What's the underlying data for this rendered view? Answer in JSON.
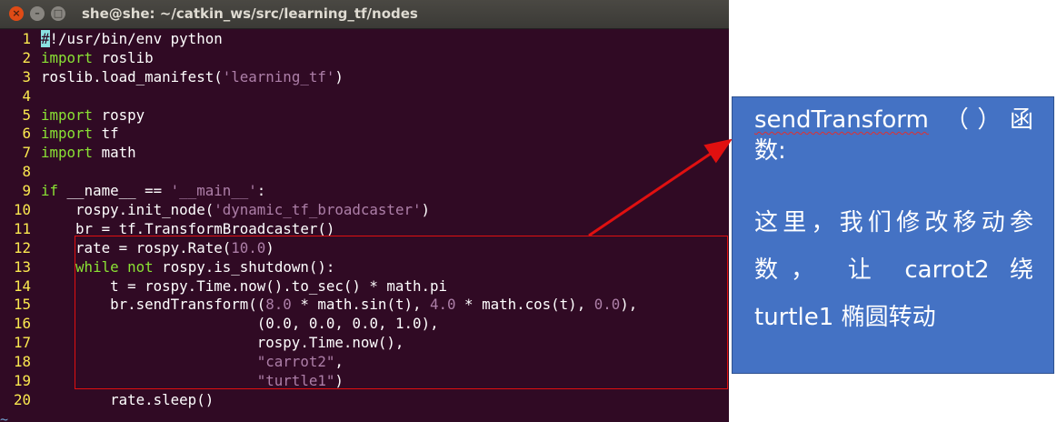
{
  "window": {
    "title": "she@she: ~/catkin_ws/src/learning_tf/nodes",
    "close_glyph": "×",
    "min_glyph": "–",
    "max_glyph": "□"
  },
  "code": {
    "lines": [
      {
        "n": "1",
        "segs": [
          {
            "t": "#",
            "c": "cursor"
          },
          {
            "t": "!/usr/bin/env python",
            "c": "comment"
          }
        ]
      },
      {
        "n": "2",
        "segs": [
          {
            "t": "import",
            "c": "kw"
          },
          {
            "t": " roslib",
            "c": ""
          }
        ]
      },
      {
        "n": "3",
        "segs": [
          {
            "t": "roslib.load_manifest(",
            "c": ""
          },
          {
            "t": "'learning_tf'",
            "c": "str"
          },
          {
            "t": ")",
            "c": ""
          }
        ]
      },
      {
        "n": "4",
        "segs": []
      },
      {
        "n": "5",
        "segs": [
          {
            "t": "import",
            "c": "kw"
          },
          {
            "t": " rospy",
            "c": ""
          }
        ]
      },
      {
        "n": "6",
        "segs": [
          {
            "t": "import",
            "c": "kw"
          },
          {
            "t": " tf",
            "c": ""
          }
        ]
      },
      {
        "n": "7",
        "segs": [
          {
            "t": "import",
            "c": "kw"
          },
          {
            "t": " math",
            "c": ""
          }
        ]
      },
      {
        "n": "8",
        "segs": []
      },
      {
        "n": "9",
        "segs": [
          {
            "t": "if",
            "c": "kw"
          },
          {
            "t": " __name__ == ",
            "c": ""
          },
          {
            "t": "'__main__'",
            "c": "str"
          },
          {
            "t": ":",
            "c": ""
          }
        ]
      },
      {
        "n": "10",
        "segs": [
          {
            "t": "    rospy.init_node(",
            "c": ""
          },
          {
            "t": "'dynamic_tf_broadcaster'",
            "c": "str"
          },
          {
            "t": ")",
            "c": ""
          }
        ]
      },
      {
        "n": "11",
        "segs": [
          {
            "t": "    br = tf.TransformBroadcaster()",
            "c": ""
          }
        ]
      },
      {
        "n": "12",
        "segs": [
          {
            "t": "    rate = rospy.Rate(",
            "c": ""
          },
          {
            "t": "10.0",
            "c": "num"
          },
          {
            "t": ")",
            "c": ""
          }
        ]
      },
      {
        "n": "13",
        "segs": [
          {
            "t": "    ",
            "c": ""
          },
          {
            "t": "while",
            "c": "kw"
          },
          {
            "t": " ",
            "c": ""
          },
          {
            "t": "not",
            "c": "kw"
          },
          {
            "t": " rospy.is_shutdown():",
            "c": ""
          }
        ]
      },
      {
        "n": "14",
        "segs": [
          {
            "t": "        t = rospy.Time.now().to_sec() * math.pi",
            "c": ""
          }
        ]
      },
      {
        "n": "15",
        "segs": [
          {
            "t": "        br.sendTransform((",
            "c": ""
          },
          {
            "t": "8.0",
            "c": "num"
          },
          {
            "t": " * math.sin(t), ",
            "c": ""
          },
          {
            "t": "4.0",
            "c": "num"
          },
          {
            "t": " * math.cos(t), ",
            "c": ""
          },
          {
            "t": "0.0",
            "c": "num"
          },
          {
            "t": "),",
            "c": ""
          }
        ]
      },
      {
        "n": "16",
        "segs": [
          {
            "t": "                         (",
            "c": ""
          },
          {
            "t": "0.0",
            "c": ""
          },
          {
            "t": ", ",
            "c": ""
          },
          {
            "t": "0.0",
            "c": ""
          },
          {
            "t": ", ",
            "c": ""
          },
          {
            "t": "0.0",
            "c": ""
          },
          {
            "t": ", ",
            "c": ""
          },
          {
            "t": "1.0",
            "c": ""
          },
          {
            "t": "),",
            "c": ""
          }
        ]
      },
      {
        "n": "17",
        "segs": [
          {
            "t": "                         rospy.Time.now(),",
            "c": ""
          }
        ]
      },
      {
        "n": "18",
        "segs": [
          {
            "t": "                         ",
            "c": ""
          },
          {
            "t": "\"carrot2\"",
            "c": "str"
          },
          {
            "t": ",",
            "c": ""
          }
        ]
      },
      {
        "n": "19",
        "segs": [
          {
            "t": "                         ",
            "c": ""
          },
          {
            "t": "\"turtle1\"",
            "c": "str"
          },
          {
            "t": ")",
            "c": ""
          }
        ]
      },
      {
        "n": "20",
        "segs": [
          {
            "t": "        rate.sleep()",
            "c": ""
          }
        ]
      }
    ],
    "tilde": "~"
  },
  "callout": {
    "title_word": "sendTransform",
    "title_rest": " （）函数:",
    "body": "这里，我们修改移动参数， 让 carrot2 绕 turtle1 椭圆转动"
  },
  "colors": {
    "terminal_bg": "#300a24",
    "line_number": "#fce94f",
    "keyword": "#8ae234",
    "string": "#ad7fa8",
    "callout_bg": "#4472c4",
    "annotation_red": "#e01010"
  }
}
